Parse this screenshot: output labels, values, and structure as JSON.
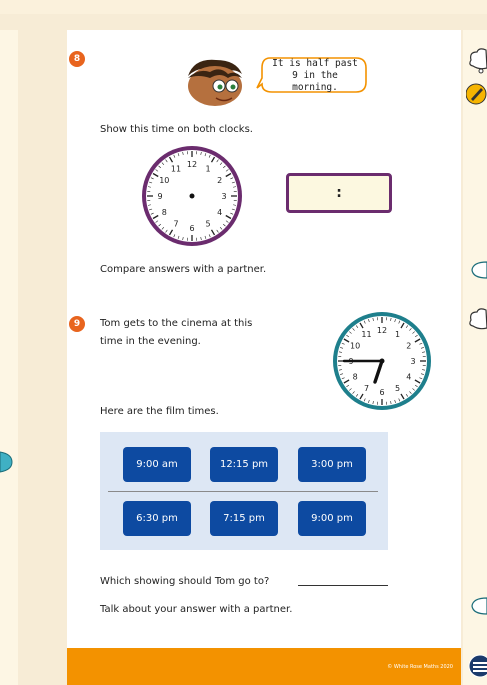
{
  "question8": {
    "number": "8",
    "speech": "It is half past 9 in the morning.",
    "instruction": "Show this time on both clocks.",
    "clock_numbers": [
      "12",
      "1",
      "2",
      "3",
      "4",
      "5",
      "6",
      "7",
      "8",
      "9",
      "10",
      "11"
    ],
    "digital_display": ":",
    "compare": "Compare answers with a partner."
  },
  "question9": {
    "number": "9",
    "line1": "Tom gets to the cinema at this",
    "line2": "time in the evening.",
    "clock_numbers": [
      "12",
      "1",
      "2",
      "3",
      "4",
      "5",
      "6",
      "7",
      "8",
      "9",
      "10",
      "11"
    ],
    "clock_time": "6:45",
    "film_intro": "Here are the film times.",
    "film_times": [
      "9:00 am",
      "12:15 pm",
      "3:00 pm",
      "6:30 pm",
      "7:15 pm",
      "9:00 pm"
    ],
    "question": "Which showing should Tom go to?",
    "talk": "Talk about your answer with a partner."
  },
  "footer": {
    "copyright": "© White Rose Maths 2020"
  },
  "colors": {
    "orange": "#f39200",
    "badge": "#e8641e",
    "film_button": "#0d4aa1",
    "clock_rim_purple": "#6b2c6e",
    "clock_rim_teal": "#1e7f8c"
  },
  "icons": [
    "boy-character-icon",
    "speech-bubble-icon",
    "analog-clock-icon",
    "digital-clock-icon",
    "thought-cloud-icon",
    "pencil-icon",
    "white-rose-logo-icon"
  ]
}
